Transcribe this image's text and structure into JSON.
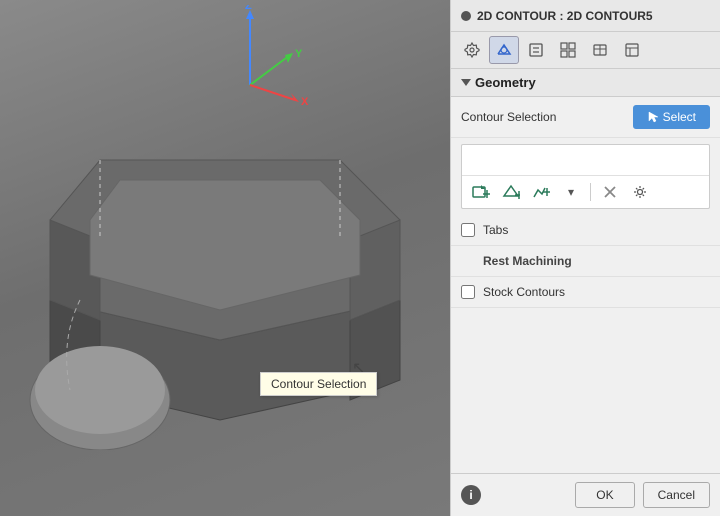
{
  "header": {
    "icon": "●",
    "title": "2D CONTOUR : 2D CONTOUR5"
  },
  "toolbar": {
    "buttons": [
      {
        "icon": "⚙",
        "label": "settings-icon",
        "active": false
      },
      {
        "icon": "◈",
        "label": "geometry-icon",
        "active": true
      },
      {
        "icon": "◧",
        "label": "passes-icon",
        "active": false
      },
      {
        "icon": "⊞",
        "label": "linking-icon",
        "active": false
      },
      {
        "icon": "▦",
        "label": "pattern-icon",
        "active": false
      },
      {
        "icon": "⊟",
        "label": "advanced-icon",
        "active": false
      }
    ]
  },
  "geometry": {
    "section_label": "Geometry",
    "contour_selection_label": "Contour Selection",
    "select_button_label": "Select",
    "tabs_label": "Tabs",
    "tabs_checked": false,
    "rest_machining_label": "Rest Machining",
    "stock_contours_label": "Stock Contours",
    "stock_contours_checked": false
  },
  "tooltip": {
    "text": "Contour Selection"
  },
  "footer": {
    "info_icon": "i",
    "ok_label": "OK",
    "cancel_label": "Cancel"
  },
  "sel_icons": [
    {
      "icon": "▣",
      "title": "add-contour"
    },
    {
      "icon": "⬡",
      "title": "add-face"
    },
    {
      "icon": "⬢",
      "title": "add-sketch"
    },
    {
      "icon": "▾",
      "title": "dropdown"
    },
    {
      "icon": "✕",
      "title": "delete"
    },
    {
      "icon": "⚙",
      "title": "settings"
    }
  ]
}
